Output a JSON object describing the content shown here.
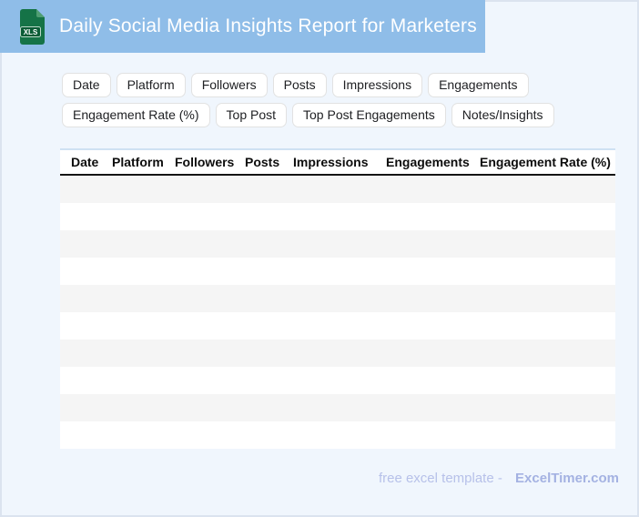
{
  "header": {
    "title": "Daily Social Media Insights Report for Marketers",
    "icon_label": "XLS"
  },
  "chips": {
    "row1": [
      "Date",
      "Platform",
      "Followers",
      "Posts",
      "Impressions",
      "Engagements"
    ],
    "row2": [
      "Engagement Rate (%)",
      "Top Post",
      "Top Post Engagements",
      "Notes/Insights"
    ]
  },
  "table": {
    "columns": [
      "Date",
      "Platform",
      "Followers",
      "Posts",
      "Impressions",
      "Engagements",
      "Engagement Rate (%)"
    ],
    "rows": [
      "",
      "",
      "",
      "",
      "",
      "",
      "",
      "",
      "",
      ""
    ]
  },
  "footer": {
    "prefix": "free excel template -",
    "brand": "ExcelTimer.com"
  },
  "colors": {
    "header_band": "#8fbde8",
    "page_background": "#f0f6fd",
    "frame_border": "#dbe3ef",
    "stripe_gray": "#f5f5f5",
    "table_divider": "#141414",
    "icon_green": "#157347",
    "icon_fold_green": "#4f9e72",
    "footer_text": "#b7c1e9",
    "footer_brand": "#a4b2e2"
  }
}
